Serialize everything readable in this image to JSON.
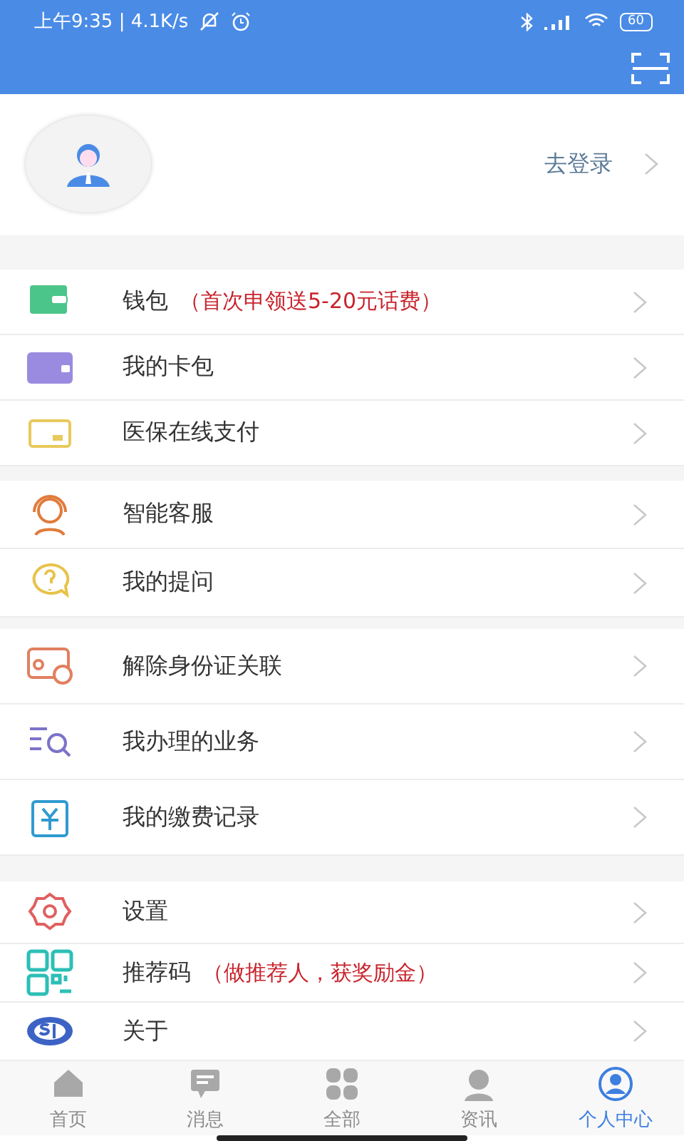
{
  "status_bar": {
    "time": "上午9:35 | 4.1K/s",
    "battery": "60"
  },
  "profile": {
    "login": "去登录"
  },
  "menu_groups": [
    {
      "rows": [
        {
          "label": "钱包",
          "promo": "（首次申领送5-20元话费）"
        },
        {
          "label": "我的卡包"
        },
        {
          "label": "医保在线支付"
        }
      ]
    },
    {
      "rows": [
        {
          "label": "智能客服"
        },
        {
          "label": "我的提问"
        }
      ]
    },
    {
      "rows": [
        {
          "label": "解除身份证关联"
        },
        {
          "label": "我办理的业务"
        },
        {
          "label": "我的缴费记录"
        }
      ]
    },
    {
      "rows": [
        {
          "label": "设置"
        },
        {
          "label": "推荐码",
          "promo": "（做推荐人，获奖励金）"
        },
        {
          "label": "关于"
        }
      ]
    }
  ],
  "tab_bar": [
    {
      "label": "首页",
      "selected": false
    },
    {
      "label": "消息",
      "selected": false
    },
    {
      "label": "全部",
      "selected": false
    },
    {
      "label": "资讯",
      "selected": false
    },
    {
      "label": "个人中心",
      "selected": true
    }
  ]
}
